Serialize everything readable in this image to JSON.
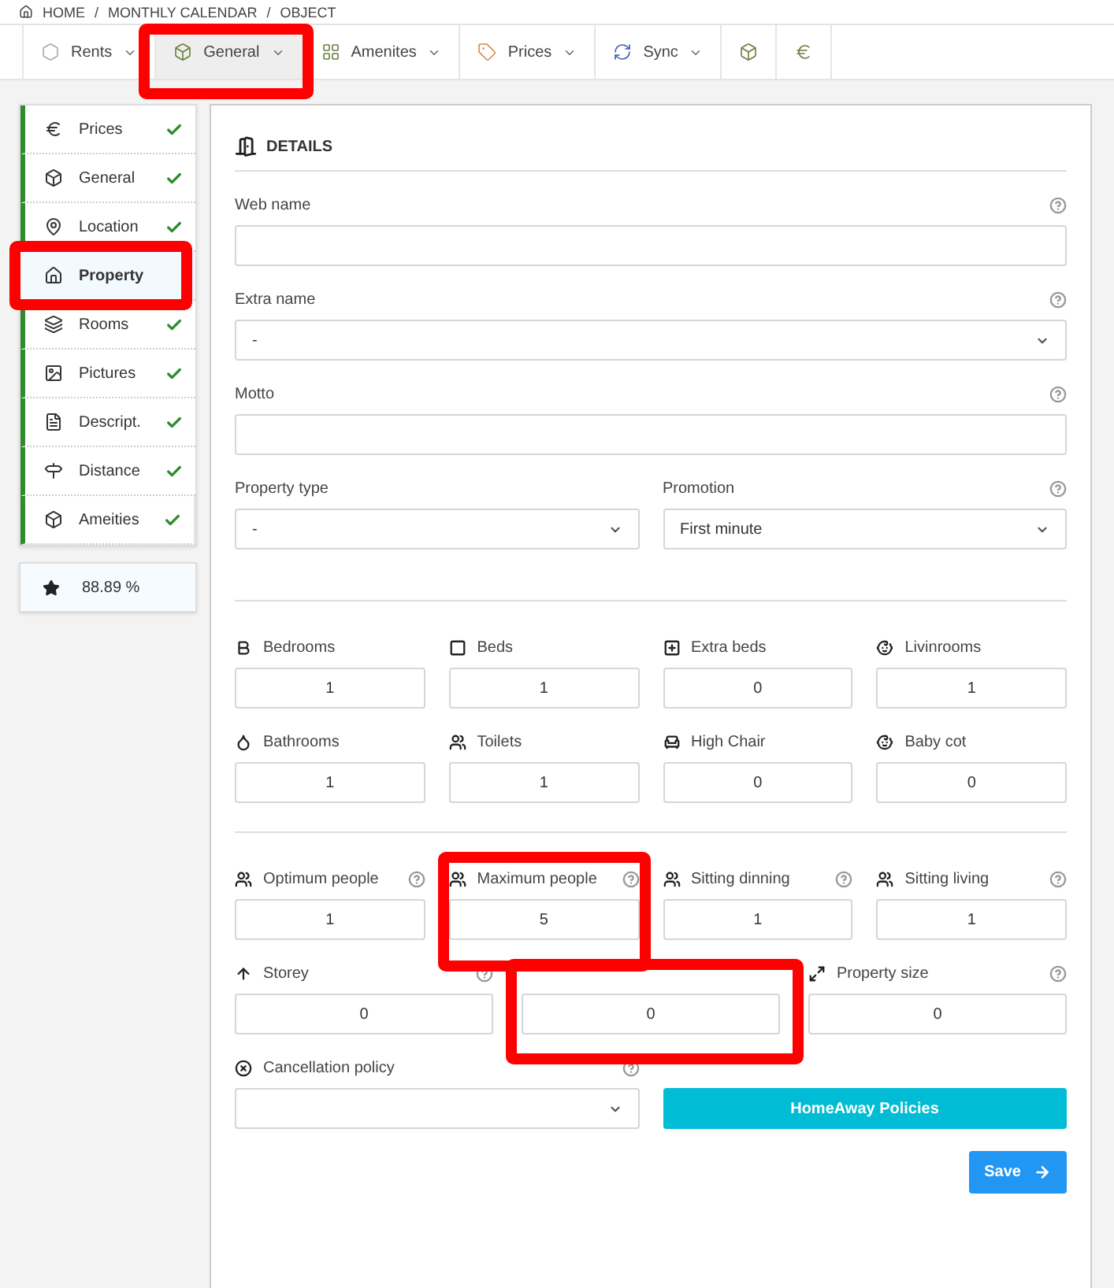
{
  "breadcrumb": [
    "HOME",
    "/",
    "MONTHLY CALENDAR",
    "/",
    "OBJECT"
  ],
  "toolbar": {
    "tabs": [
      {
        "kind": "menu",
        "label": "Rents",
        "selected": false
      },
      {
        "kind": "menu",
        "label": "General",
        "selected": true,
        "highlighted": true
      },
      {
        "kind": "menu",
        "label": "Amenites",
        "selected": false
      },
      {
        "kind": "menu",
        "label": "Prices",
        "selected": false
      },
      {
        "kind": "menu",
        "label": "Sync",
        "selected": false
      },
      {
        "kind": "icon",
        "selected": false
      },
      {
        "kind": "icon",
        "selected": false
      }
    ]
  },
  "sidebar": {
    "items": [
      {
        "label": "Prices",
        "done": true,
        "selected": false
      },
      {
        "label": "General",
        "done": true,
        "selected": false
      },
      {
        "label": "Location",
        "done": true,
        "selected": false
      },
      {
        "label": "Property",
        "done": false,
        "selected": true,
        "highlighted": true
      },
      {
        "label": "Rooms",
        "done": true,
        "selected": false
      },
      {
        "label": "Pictures",
        "done": true,
        "selected": false
      },
      {
        "label": "Descript.",
        "done": true,
        "selected": false
      },
      {
        "label": "Distance",
        "done": true,
        "selected": false
      },
      {
        "label": "Ameities",
        "done": true,
        "selected": false
      }
    ],
    "score": "88.89 %"
  },
  "details": {
    "title": "DETAILS",
    "sections": [
      {
        "rows": [
          [
            {
              "kind": "text",
              "label": "Web name",
              "help": true
            }
          ],
          [
            {
              "kind": "select",
              "label": "Extra name",
              "value": "-",
              "help": true
            }
          ],
          [
            {
              "kind": "text",
              "label": "Motto",
              "help": true
            }
          ],
          [
            {
              "kind": "select",
              "label": "Property type",
              "value": "-"
            },
            {
              "kind": "select",
              "label": "Promotion",
              "value": "First minute",
              "help": true
            }
          ]
        ]
      },
      {
        "rows": [
          [
            {
              "kind": "number",
              "label": "Bedrooms",
              "value": "1"
            },
            {
              "kind": "number",
              "label": "Beds",
              "value": "1"
            },
            {
              "kind": "number",
              "label": "Extra beds",
              "value": "0"
            },
            {
              "kind": "number",
              "label": "Livinrooms",
              "value": "1"
            }
          ],
          [
            {
              "kind": "number",
              "label": "Bathrooms",
              "value": "1"
            },
            {
              "kind": "number",
              "label": "Toilets",
              "value": "1"
            },
            {
              "kind": "number",
              "label": "High Chair",
              "value": "0"
            },
            {
              "kind": "number",
              "label": "Baby cot",
              "value": "0"
            }
          ]
        ]
      },
      {
        "rows": [
          [
            {
              "kind": "number",
              "label": "Optimum people",
              "value": "1",
              "help": true
            },
            {
              "kind": "number",
              "label": "Maximum people",
              "value": "5",
              "help": true,
              "highlighted": true
            },
            {
              "kind": "number",
              "label": "Sitting dinning",
              "value": "1",
              "help": true
            },
            {
              "kind": "number",
              "label": "Sitting living",
              "value": "1",
              "help": true
            }
          ],
          [
            {
              "kind": "number",
              "label": "Storey",
              "value": "0",
              "help": true
            },
            {
              "kind": "number",
              "value": "0",
              "highlighted": true
            },
            {
              "kind": "number",
              "label": "Property size",
              "value": "0",
              "help": true
            }
          ],
          [
            {
              "kind": "select",
              "label": "Cancellation policy",
              "help": true
            },
            {
              "kind": "button",
              "label": "HomeAway Policies"
            }
          ]
        ]
      }
    ],
    "save": "Save"
  }
}
